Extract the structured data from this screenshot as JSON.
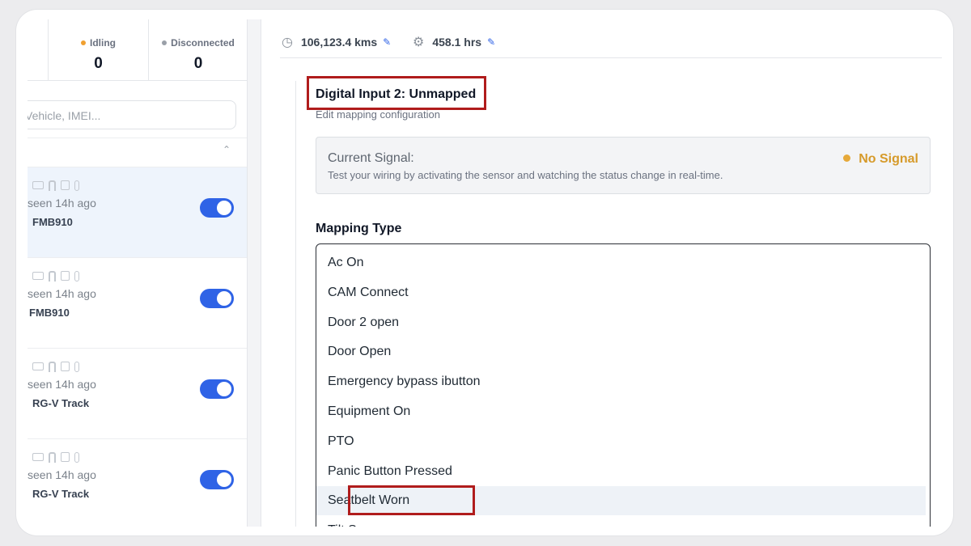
{
  "stats": {
    "idling": {
      "label": "Idling",
      "value": "0",
      "color": "#f0a030"
    },
    "disconnected": {
      "label": "Disconnected",
      "value": "0",
      "color": "#9aa0a8"
    }
  },
  "search": {
    "placeholder": "Vehicle, IMEI..."
  },
  "vehicles": [
    {
      "seen": "seen 14h ago",
      "model": "FMB910"
    },
    {
      "seen": "seen 14h ago",
      "model": "FMB910"
    },
    {
      "seen": "seen 14h ago",
      "model": "RG-V Track"
    },
    {
      "seen": "seen 14h ago",
      "model": "RG-V Track"
    }
  ],
  "topbar": {
    "odometer": "106,123.4 kms",
    "hours": "458.1 hrs"
  },
  "input": {
    "title": "Digital Input 2: Unmapped",
    "subtitle": "Edit mapping configuration"
  },
  "signal": {
    "label": "Current Signal:",
    "description": "Test your wiring by activating the sensor and watching the status change in real-time.",
    "status": "No Signal",
    "status_color": "#d69a2a"
  },
  "mapping": {
    "label": "Mapping Type",
    "options": [
      "Ac On",
      "CAM Connect",
      "Door 2 open",
      "Door Open",
      "Emergency bypass ibutton",
      "Equipment On",
      "PTO",
      "Panic Button Pressed",
      "Seatbelt Worn",
      "Tilt Sensor"
    ],
    "highlighted": "Seatbelt Worn"
  }
}
